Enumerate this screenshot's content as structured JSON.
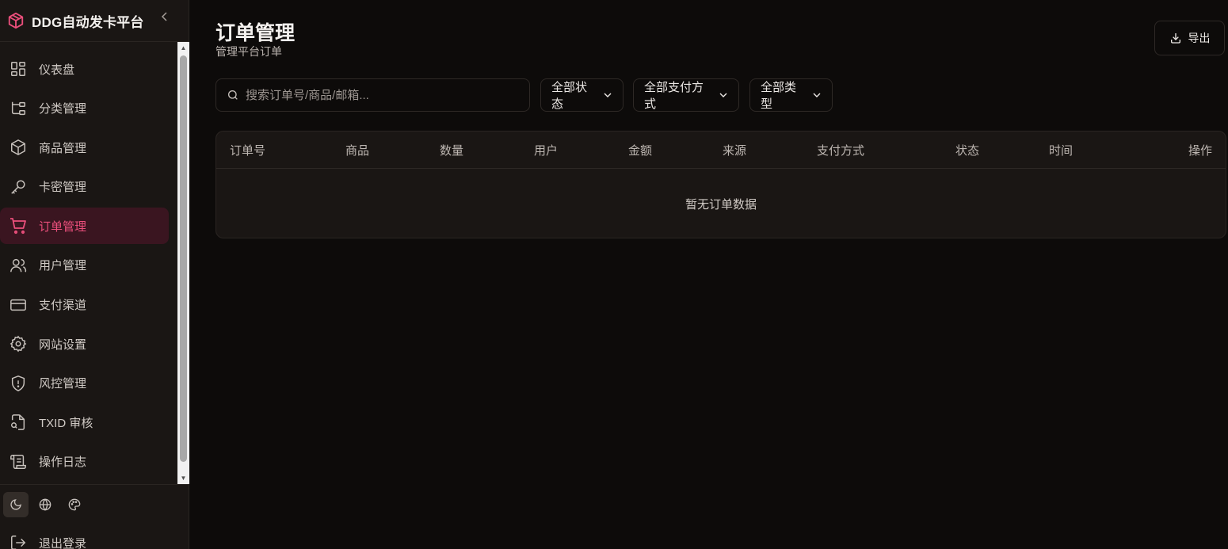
{
  "brand": {
    "title": "DDG自动发卡平台",
    "accent": "#ec4f7c"
  },
  "sidebar": {
    "items": [
      {
        "label": "仪表盘",
        "icon": "dashboard-icon",
        "active": false
      },
      {
        "label": "分类管理",
        "icon": "tree-icon",
        "active": false
      },
      {
        "label": "商品管理",
        "icon": "box-icon",
        "active": false
      },
      {
        "label": "卡密管理",
        "icon": "key-icon",
        "active": false
      },
      {
        "label": "订单管理",
        "icon": "cart-icon",
        "active": true
      },
      {
        "label": "用户管理",
        "icon": "users-icon",
        "active": false
      },
      {
        "label": "支付渠道",
        "icon": "credit-card-icon",
        "active": false
      },
      {
        "label": "网站设置",
        "icon": "gear-icon",
        "active": false
      },
      {
        "label": "风控管理",
        "icon": "shield-alert-icon",
        "active": false
      },
      {
        "label": "TXID 审核",
        "icon": "file-search-icon",
        "active": false
      },
      {
        "label": "操作日志",
        "icon": "scroll-icon",
        "active": false
      }
    ],
    "tools": [
      "moon-icon",
      "globe-icon",
      "palette-icon"
    ],
    "logout": "退出登录"
  },
  "main": {
    "title": "订单管理",
    "subtitle": "管理平台订单",
    "export": "导出",
    "search_placeholder": "搜索订单号/商品/邮箱...",
    "filters": {
      "status": "全部状态",
      "payment": "全部支付方式",
      "type": "全部类型"
    },
    "table": {
      "columns": [
        "订单号",
        "商品",
        "数量",
        "用户",
        "金额",
        "来源",
        "支付方式",
        "状态",
        "时间",
        "操作"
      ],
      "empty": "暂无订单数据"
    }
  }
}
